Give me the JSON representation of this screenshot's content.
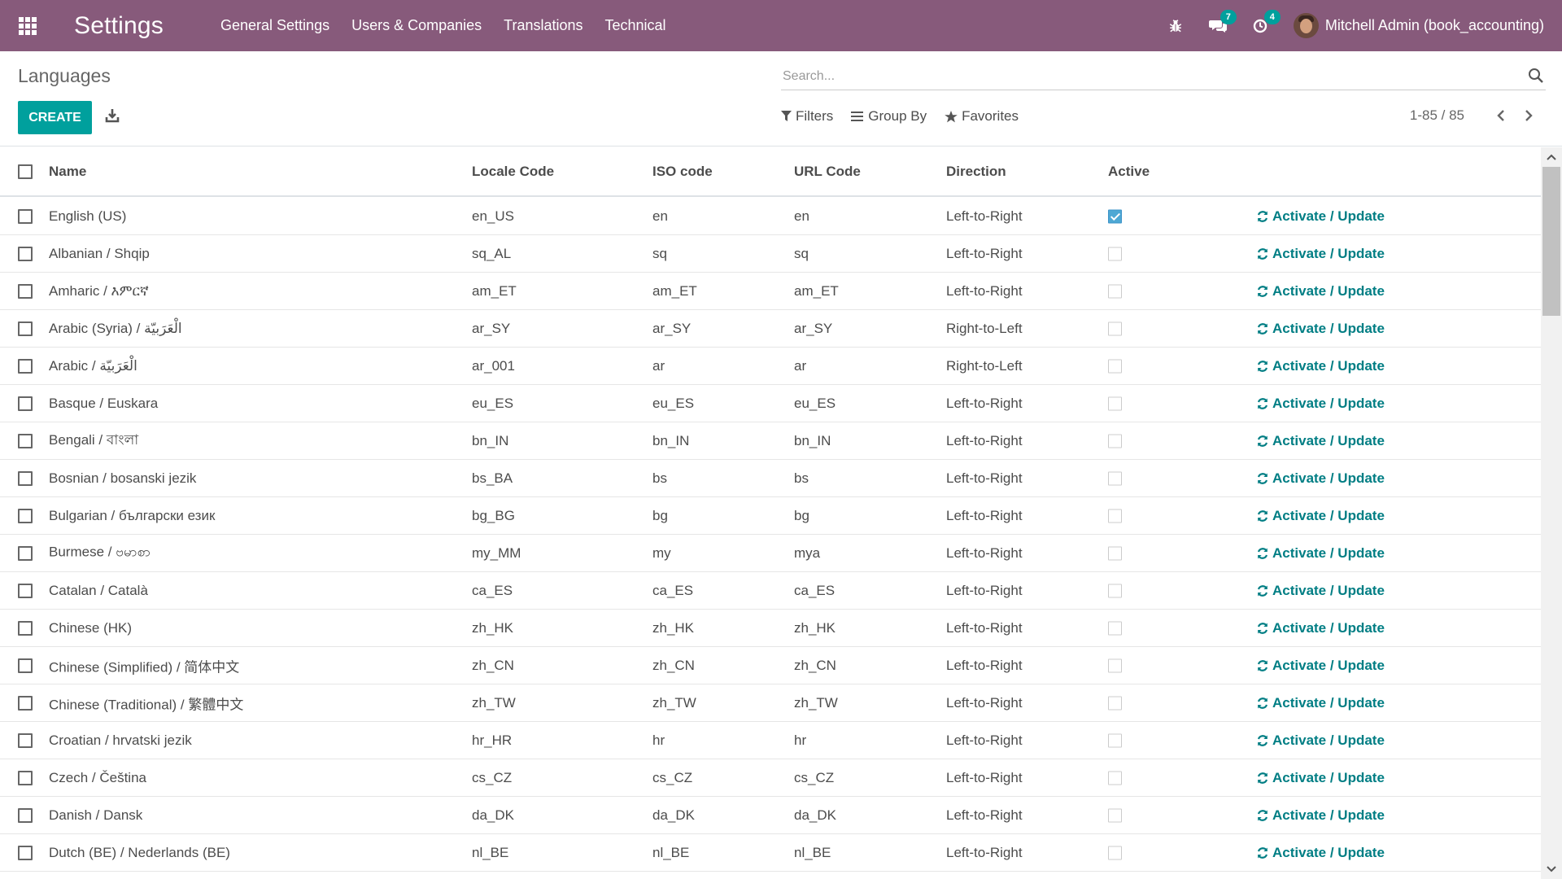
{
  "navbar": {
    "app_title": "Settings",
    "menu": [
      "General Settings",
      "Users & Companies",
      "Translations",
      "Technical"
    ],
    "messages_count": "7",
    "activities_count": "4",
    "user_name": "Mitchell Admin (book_accounting)",
    "color": "#875a7b"
  },
  "control_panel": {
    "breadcrumb": "Languages",
    "create_label": "CREATE",
    "search_placeholder": "Search...",
    "filters_label": "Filters",
    "group_by_label": "Group By",
    "favorites_label": "Favorites",
    "pager_value": "1-85 / 85"
  },
  "table": {
    "headers": {
      "name": "Name",
      "locale": "Locale Code",
      "iso": "ISO code",
      "url": "URL Code",
      "direction": "Direction",
      "active": "Active"
    },
    "action_label": "Activate / Update",
    "accent_color": "#017e84",
    "rows": [
      {
        "name": "English (US)",
        "locale": "en_US",
        "iso": "en",
        "url": "en",
        "direction": "Left-to-Right",
        "active": true
      },
      {
        "name": "Albanian / Shqip",
        "locale": "sq_AL",
        "iso": "sq",
        "url": "sq",
        "direction": "Left-to-Right",
        "active": false
      },
      {
        "name": "Amharic / እምርኛ",
        "locale": "am_ET",
        "iso": "am_ET",
        "url": "am_ET",
        "direction": "Left-to-Right",
        "active": false
      },
      {
        "name": "Arabic (Syria) / الْعَرَبيّة",
        "locale": "ar_SY",
        "iso": "ar_SY",
        "url": "ar_SY",
        "direction": "Right-to-Left",
        "active": false
      },
      {
        "name": "Arabic / الْعَرَبيّة",
        "locale": "ar_001",
        "iso": "ar",
        "url": "ar",
        "direction": "Right-to-Left",
        "active": false
      },
      {
        "name": "Basque / Euskara",
        "locale": "eu_ES",
        "iso": "eu_ES",
        "url": "eu_ES",
        "direction": "Left-to-Right",
        "active": false
      },
      {
        "name": "Bengali / বাংলা",
        "locale": "bn_IN",
        "iso": "bn_IN",
        "url": "bn_IN",
        "direction": "Left-to-Right",
        "active": false
      },
      {
        "name": "Bosnian / bosanski jezik",
        "locale": "bs_BA",
        "iso": "bs",
        "url": "bs",
        "direction": "Left-to-Right",
        "active": false
      },
      {
        "name": "Bulgarian / български език",
        "locale": "bg_BG",
        "iso": "bg",
        "url": "bg",
        "direction": "Left-to-Right",
        "active": false
      },
      {
        "name": "Burmese / ဗမာစာ",
        "locale": "my_MM",
        "iso": "my",
        "url": "mya",
        "direction": "Left-to-Right",
        "active": false
      },
      {
        "name": "Catalan / Català",
        "locale": "ca_ES",
        "iso": "ca_ES",
        "url": "ca_ES",
        "direction": "Left-to-Right",
        "active": false
      },
      {
        "name": "Chinese (HK)",
        "locale": "zh_HK",
        "iso": "zh_HK",
        "url": "zh_HK",
        "direction": "Left-to-Right",
        "active": false
      },
      {
        "name": "Chinese (Simplified) / 简体中文",
        "locale": "zh_CN",
        "iso": "zh_CN",
        "url": "zh_CN",
        "direction": "Left-to-Right",
        "active": false
      },
      {
        "name": "Chinese (Traditional) / 繁體中文",
        "locale": "zh_TW",
        "iso": "zh_TW",
        "url": "zh_TW",
        "direction": "Left-to-Right",
        "active": false
      },
      {
        "name": "Croatian / hrvatski jezik",
        "locale": "hr_HR",
        "iso": "hr",
        "url": "hr",
        "direction": "Left-to-Right",
        "active": false
      },
      {
        "name": "Czech / Čeština",
        "locale": "cs_CZ",
        "iso": "cs_CZ",
        "url": "cs_CZ",
        "direction": "Left-to-Right",
        "active": false
      },
      {
        "name": "Danish / Dansk",
        "locale": "da_DK",
        "iso": "da_DK",
        "url": "da_DK",
        "direction": "Left-to-Right",
        "active": false
      },
      {
        "name": "Dutch (BE) / Nederlands (BE)",
        "locale": "nl_BE",
        "iso": "nl_BE",
        "url": "nl_BE",
        "direction": "Left-to-Right",
        "active": false
      }
    ]
  }
}
